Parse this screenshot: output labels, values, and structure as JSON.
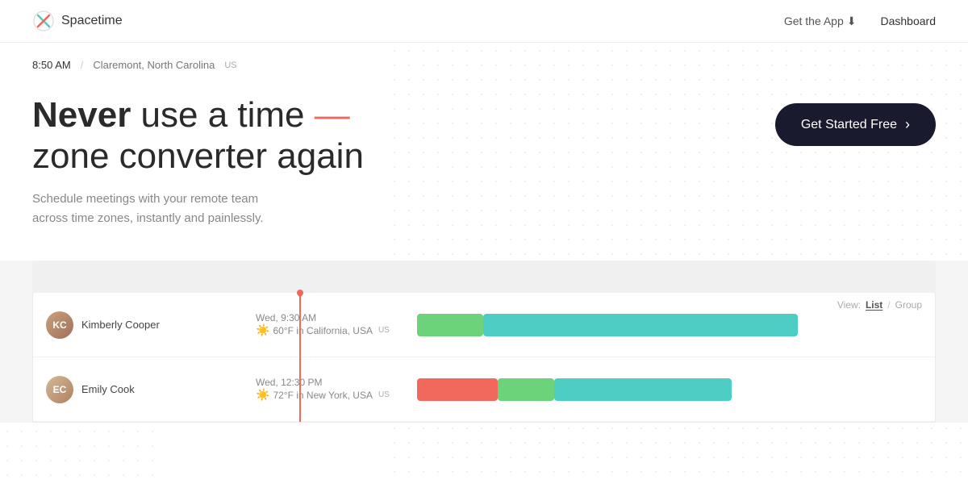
{
  "header": {
    "logo_text": "Spacetime",
    "get_app_label": "Get the App",
    "dashboard_label": "Dashboard"
  },
  "location": {
    "time": "8:50 AM",
    "city": "Claremont, North Carolina",
    "country": "us"
  },
  "hero": {
    "title_bold": "Never",
    "title_rest": " use a time ",
    "title_dash": "—",
    "title_line2": "zone converter again",
    "subtitle_line1": "Schedule meetings with your remote team",
    "subtitle_line2": "across time zones, instantly and painlessly.",
    "cta_label": "Get Started Free",
    "cta_arrow": "›"
  },
  "timeline": {
    "view_label": "View:",
    "view_list": "List",
    "view_group": "Group",
    "members": [
      {
        "name": "Kimberly Cooper",
        "initials": "KC",
        "datetime": "Wed, 9:30 AM",
        "weather": "60°F in California, USA",
        "country": "us"
      },
      {
        "name": "Emily Cook",
        "initials": "EC",
        "datetime": "Wed, 12:30 PM",
        "weather": "72°F in New York, USA",
        "country": "us"
      }
    ]
  }
}
